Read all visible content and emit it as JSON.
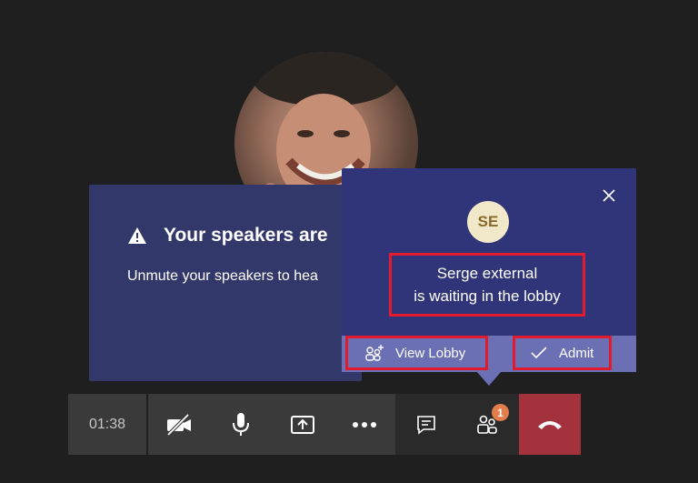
{
  "speaker_notice": {
    "title": "Your speakers are",
    "body": "Unmute your speakers to hea"
  },
  "lobby_popup": {
    "avatar_initials": "SE",
    "message_line1": "Serge external",
    "message_line2": "is waiting in the lobby",
    "view_lobby_label": "View Lobby",
    "admit_label": "Admit"
  },
  "call_bar": {
    "timer": "01:38",
    "participants_badge": "1"
  },
  "colors": {
    "background": "#201f1f",
    "panel": "#33386b",
    "popup": "#2f3578",
    "action_bar": "#6b6fb3",
    "highlight": "#e11b2e",
    "hangup": "#a4323d",
    "badge": "#e37d4b"
  }
}
